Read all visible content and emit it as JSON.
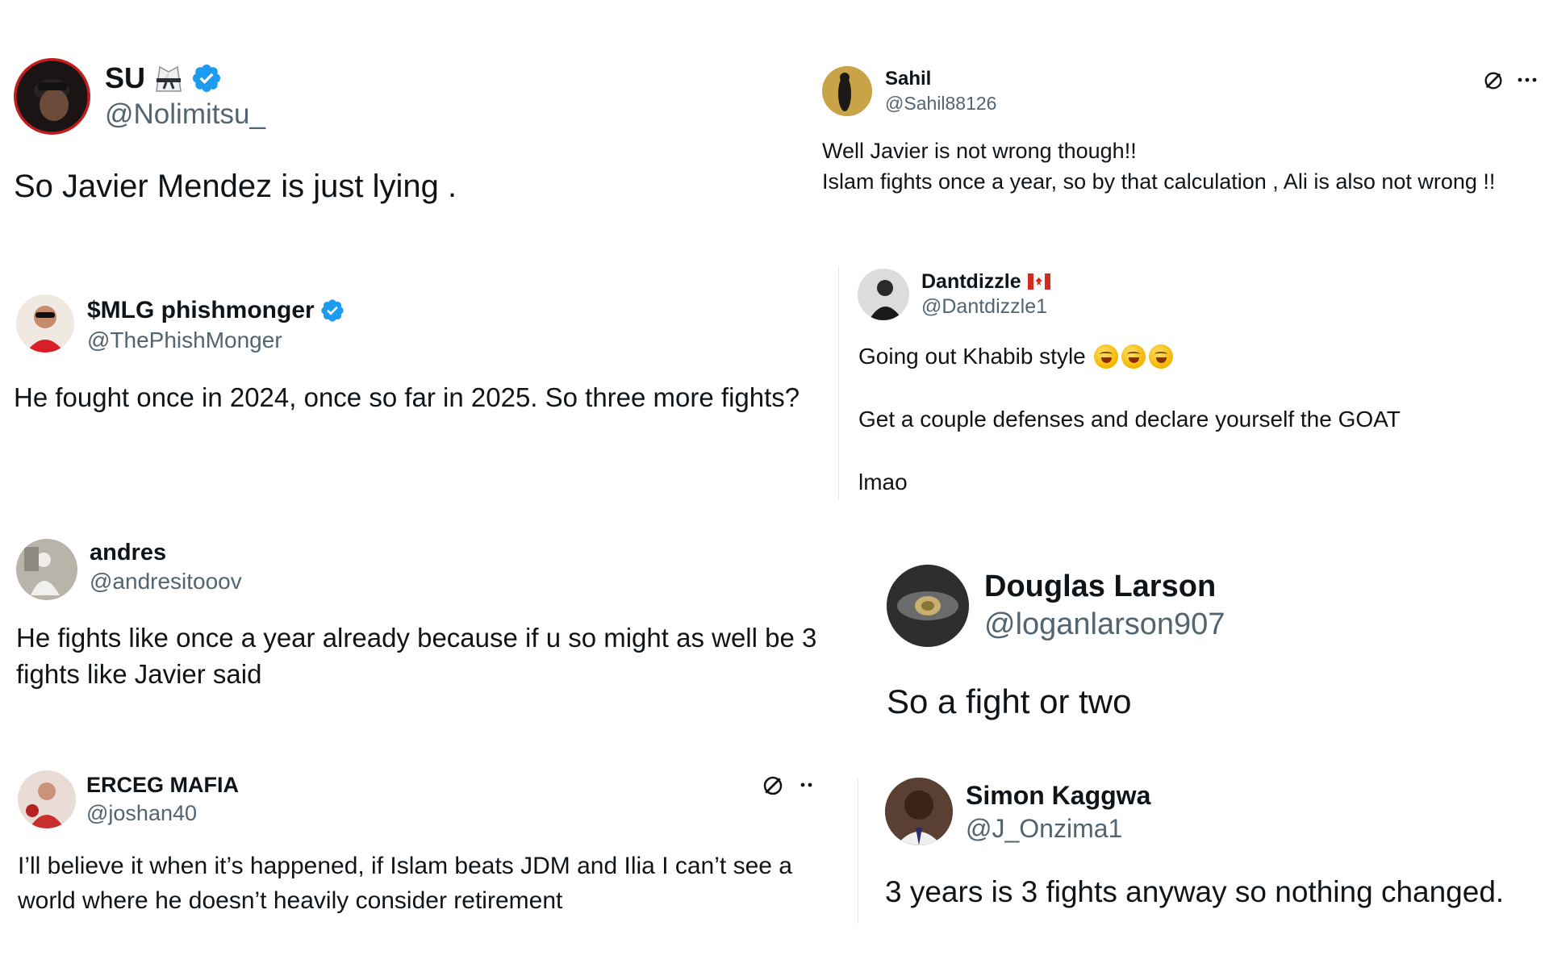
{
  "tweets": [
    {
      "id": "su",
      "name": "SU",
      "handle": "@Nolimitsu_",
      "text": "So Javier Mendez is just lying ."
    },
    {
      "id": "sahil",
      "name": "Sahil",
      "handle": "@Sahil88126",
      "text_lines": [
        "Well Javier is not wrong though!!",
        "Islam fights once a year, so by that calculation , Ali is also not wrong !!"
      ]
    },
    {
      "id": "phish",
      "name": "$MLG phishmonger",
      "handle": "@ThePhishMonger",
      "text": "He fought once in 2024, once so far in 2025. So three more fights?"
    },
    {
      "id": "dantdizzle",
      "name": "Dantdizzle",
      "handle": "@Dantdizzle1",
      "text_lines": [
        "Going out Khabib style",
        "Get a couple defenses and declare yourself the GOAT",
        "lmao"
      ]
    },
    {
      "id": "andres",
      "name": "andres",
      "handle": "@andresitooov",
      "text_lines": [
        "He fights like once a year already because if u so might as well be 3",
        "fights like Javier said"
      ]
    },
    {
      "id": "douglas",
      "name": "Douglas Larson",
      "handle": "@loganlarson907",
      "text": "So a fight or two"
    },
    {
      "id": "erceg",
      "name": "ERCEG MAFIA",
      "handle": "@joshan40",
      "text_lines": [
        "I’ll believe it when it’s happened, if Islam beats JDM and Ilia I can’t see a",
        "world where he doesn’t heavily consider retirement"
      ]
    },
    {
      "id": "simon",
      "name": "Simon Kaggwa",
      "handle": "@J_Onzima1",
      "text": "3 years is 3 fights anyway so nothing changed."
    }
  ],
  "colors": {
    "verified": "#1d9bf0",
    "handle": "#536471",
    "text": "#0f1419"
  },
  "icons": [
    "verified-badge-icon",
    "grok-icon",
    "more-icon",
    "karate-gi-icon",
    "canada-flag-icon",
    "rofl-emoji-icon"
  ]
}
